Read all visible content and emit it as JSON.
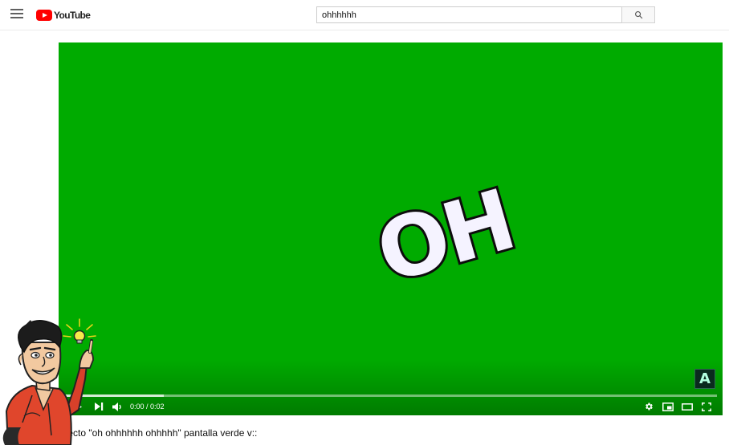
{
  "header": {
    "logo_text": "YouTube",
    "search_value": "ohhhhhh",
    "icons": {
      "menu": "hamburger-icon",
      "search": "search-icon"
    }
  },
  "video": {
    "overlay_text": "OH",
    "time_display": "0:00 / 0:02",
    "progress_played_fraction": 0.0,
    "progress_loaded_fraction": 0.16,
    "watermark_letter": "A",
    "background_color": "#00ab00",
    "progress_color": "#e00000",
    "controls": [
      "play-icon",
      "next-icon",
      "volume-icon",
      "settings-icon",
      "miniplayer-icon",
      "theater-icon",
      "fullscreen-icon"
    ]
  },
  "title": "Efecto \"oh ohhhhhh ohhhhh\" pantalla verde v::"
}
